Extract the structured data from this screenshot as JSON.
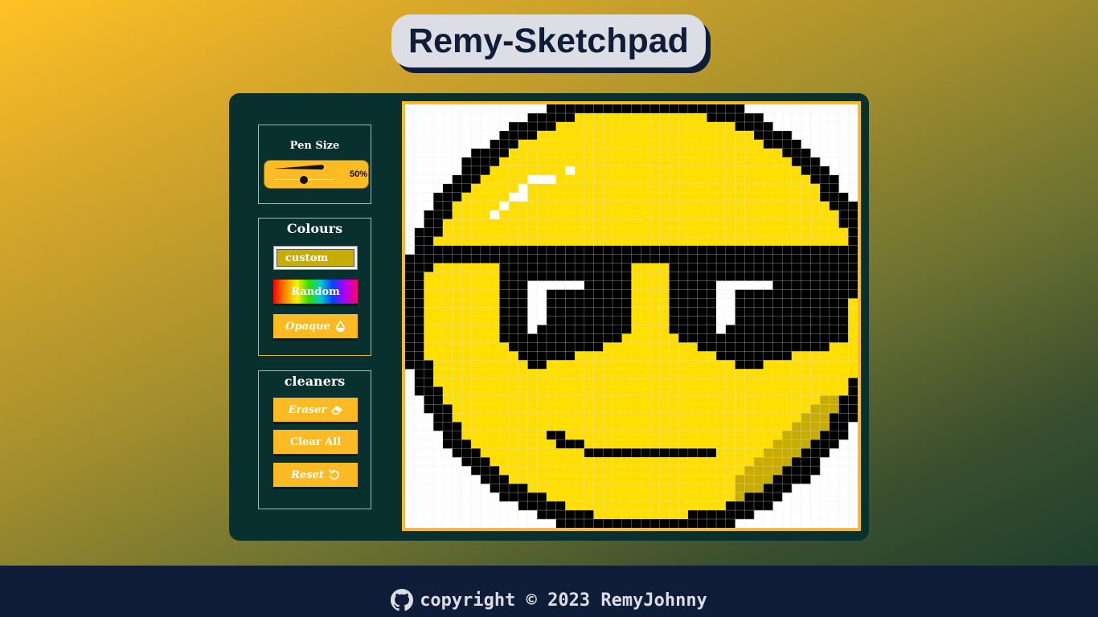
{
  "app": {
    "title": "Remy-Sketchpad"
  },
  "pen_size": {
    "label": "Pen Size",
    "value_label": "50%",
    "value": 0.5
  },
  "colours": {
    "title": "Colours",
    "custom": {
      "label": "custom",
      "color": "#c8ac00"
    },
    "random_label": "Random",
    "opaque_label": "Opaque"
  },
  "cleaners": {
    "title": "cleaners",
    "eraser_label": "Eraser",
    "clear_all_label": "Clear All",
    "reset_label": "Reset"
  },
  "canvas": {
    "grid_size": 48,
    "palette": {
      "Y": "#ffde00",
      "K": "#000000",
      "W": "#ffffff",
      "D": "#c8ac00"
    },
    "background": "#ffffff",
    "grid_line": "#e4e4e4"
  },
  "footer": {
    "text": "copyright © 2023 RemyJohnny",
    "icon": "github-icon"
  },
  "theme": {
    "accent": "#fcbb25",
    "panel": "#08302f",
    "navy": "#0f1d38",
    "title_bg": "#dddde6"
  }
}
